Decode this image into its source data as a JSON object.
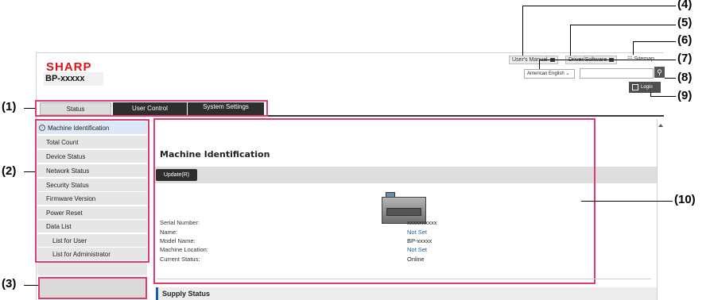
{
  "callouts": {
    "c1": "(1)",
    "c2": "(2)",
    "c3": "(3)",
    "c4": "(4)",
    "c5": "(5)",
    "c6": "(6)",
    "c7": "(7)",
    "c8": "(8)",
    "c9": "(9)",
    "c10": "(10)"
  },
  "header": {
    "logo": "SHARP",
    "model": "BP-xxxxx",
    "users_manual": "User's Manual",
    "driver_software": "Driver/Software",
    "sitemap": "Sitemap",
    "language": "American English",
    "login": "Login"
  },
  "tabs": {
    "status": "Status",
    "user_control": "User Control",
    "system_settings": "System Settings"
  },
  "menu": {
    "items": [
      "Machine Identification",
      "Total Count",
      "Device Status",
      "Network Status",
      "Security Status",
      "Firmware Version",
      "Power Reset",
      "Data List",
      "List for User",
      "List for Administrator"
    ]
  },
  "main": {
    "title": "Machine Identification",
    "update_button": "Update(R)",
    "labels": [
      "Serial Number:",
      "Name:",
      "Model Name:",
      "Machine Location:",
      "Current Status:"
    ],
    "values": [
      "xxxxxxxxxx",
      "Not Set",
      "BP-xxxxx",
      "Not Set",
      "Online"
    ],
    "supply_title": "Supply Status"
  },
  "colors": {
    "accent_box": "#e03c6a",
    "link": "#1b5ea8",
    "brand": "#e0101a"
  }
}
